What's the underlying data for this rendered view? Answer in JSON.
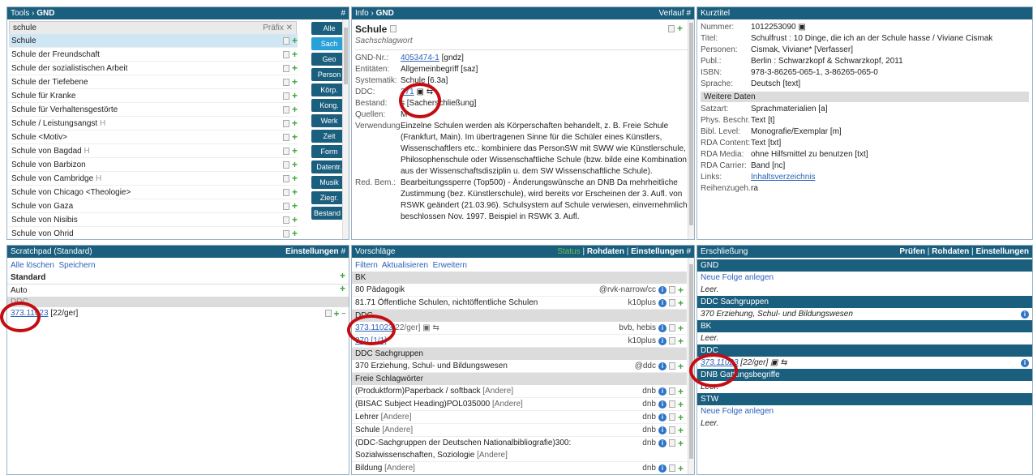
{
  "tools_gnd": {
    "title_prefix": "Tools",
    "title_sep": "›",
    "title_main": "GND",
    "hash": "#",
    "search_value": "schule",
    "prefix_label": "Präfix",
    "clear_icon": "close-icon",
    "list": [
      {
        "name": "Schule",
        "suffix": ""
      },
      {
        "name": "Schule der Freundschaft",
        "suffix": ""
      },
      {
        "name": "Schule der sozialistischen Arbeit",
        "suffix": ""
      },
      {
        "name": "Schule der Tiefebene",
        "suffix": ""
      },
      {
        "name": "Schule für Kranke",
        "suffix": ""
      },
      {
        "name": "Schule für Verhaltensgestörte",
        "suffix": ""
      },
      {
        "name": "Schule / Leistungsangst",
        "suffix": "H"
      },
      {
        "name": "Schule <Motiv>",
        "suffix": ""
      },
      {
        "name": "Schule von Bagdad",
        "suffix": "H"
      },
      {
        "name": "Schule von Barbizon",
        "suffix": ""
      },
      {
        "name": "Schule von Cambridge",
        "suffix": "H"
      },
      {
        "name": "Schule von Chicago <Theologie>",
        "suffix": ""
      },
      {
        "name": "Schule von Gaza",
        "suffix": ""
      },
      {
        "name": "Schule von Nisibis",
        "suffix": ""
      },
      {
        "name": "Schule von Ohrid",
        "suffix": ""
      }
    ],
    "buttons": [
      "Alle",
      "Sach",
      "Geo",
      "Person",
      "Körp.",
      "Kong.",
      "Werk",
      "Zeit",
      "Form",
      "Datentr.",
      "Musik",
      "Ziegr.",
      "Bestand f"
    ]
  },
  "info_gnd": {
    "title_prefix": "Info",
    "title_sep": "›",
    "title_main": "GND",
    "history": "Verlauf",
    "hash": "#",
    "heading": "Schule",
    "subtype": "Sachschlagwort",
    "fields": [
      {
        "k": "GND-Nr.:",
        "v": "4053474-1",
        "v2": " [gndz]",
        "link": true
      },
      {
        "k": "Entitäten:",
        "v": "Allgemeinbegriff [saz]",
        "v2": "",
        "link": false
      },
      {
        "k": "Systematik:",
        "v": "Schule [6.3a]",
        "v2": "",
        "link": false
      },
      {
        "k": "DDC:",
        "v": "371",
        "v2": " ▣ ⇆",
        "link": true
      },
      {
        "k": "Bestand:",
        "v": "s [Sacherschließung]",
        "v2": "",
        "link": false
      },
      {
        "k": "Quellen:",
        "v": "M",
        "v2": "",
        "link": false
      }
    ],
    "usage_label": "Verwendung:",
    "usage_text": "Einzelne Schulen werden als Körperschaften behandelt, z. B. Freie Schule (Frankfurt, Main). Im übertragenen Sinne für die Schüler eines Künstlers, Wissenschaftlers etc.: kombiniere das PersonSW mit SWW wie Künstlerschule, Philosophenschule oder Wissenschaftliche Schule (bzw. bilde eine Kombination aus der Wissenschaftsdisziplin u. dem SW Wissenschaftliche Schule).",
    "red_label": "Red. Bem.:",
    "red_text": "Bearbeitungssperre (Top500) - Änderungswünsche an DNB Da mehrheitliche Zustimmung (bez. Künstlerschule), wird bereits vor Erscheinen der 3. Aufl. von RSWK geändert (21.03.96). Schulsystem auf Schule verwiesen, einvernehmlich beschlossen Nov. 1997. Beispiel in RSWK 3. Aufl."
  },
  "kurztitel": {
    "title": "Kurztitel",
    "fields": [
      {
        "k": "Nummer:",
        "v": "1012253090 ▣"
      },
      {
        "k": "Titel:",
        "v": "Schulfrust : 10 Dinge, die ich an der Schule hasse / Viviane Cismak"
      },
      {
        "k": "Personen:",
        "v": "Cismak, Viviane* [Verfasser]"
      },
      {
        "k": "Publ.:",
        "v": "Berlin : Schwarzkopf & Schwarzkopf, 2011"
      },
      {
        "k": "ISBN:",
        "v": "978-3-86265-065-1, 3-86265-065-0"
      },
      {
        "k": "Sprache:",
        "v": "Deutsch [text]"
      }
    ],
    "section": "Weitere Daten",
    "more": [
      {
        "k": "Satzart:",
        "v": "Sprachmaterialien [a]"
      },
      {
        "k": "Phys. Beschr.:",
        "v": "Text [t]"
      },
      {
        "k": "Bibl. Level:",
        "v": "Monografie/Exemplar [m]"
      },
      {
        "k": "RDA Content:",
        "v": "Text [txt]"
      },
      {
        "k": "RDA Media:",
        "v": "ohne Hilfsmittel zu benutzen [txt]"
      },
      {
        "k": "RDA Carrier:",
        "v": "Band [nc]"
      },
      {
        "k": "Links:",
        "v": "Inhaltsverzeichnis"
      },
      {
        "k": "Reihenzugeh.:",
        "v": "ra"
      }
    ]
  },
  "scratchpad": {
    "title": "Scratchpad (Standard)",
    "settings": "Einstellungen",
    "hash": "#",
    "delete_all": "Alle löschen",
    "save": "Speichern",
    "standard": "Standard",
    "auto": "Auto",
    "group": "DDC",
    "item_link": "373.11023",
    "item_rest": "[22/ger]"
  },
  "vorschlaege": {
    "title": "Vorschläge",
    "status": "Status",
    "rohdaten": "Rohdaten",
    "settings": "Einstellungen",
    "hash": "#",
    "filter": "Filtern",
    "refresh": "Aktualisieren",
    "extend": "Erweitern",
    "groups": [
      {
        "name": "BK",
        "items": [
          {
            "text": "80 Pädagogik",
            "src": "@rvk-narrow/cc"
          },
          {
            "text": "81.71 Öffentliche Schulen, nichtöffentliche Schulen",
            "src": "k10plus"
          }
        ]
      },
      {
        "name": "DDC",
        "items": [
          {
            "text": "373.11023",
            "rest": "[22/ger] ▣ ⇆",
            "src": "bvb, hebis",
            "link": true
          },
          {
            "text": "370 [1/1]",
            "rest": "",
            "src": "k10plus",
            "link": true
          }
        ]
      },
      {
        "name": "DDC Sachgruppen",
        "items": [
          {
            "text": "370 Erziehung, Schul- und Bildungswesen",
            "src": "@ddc"
          }
        ]
      },
      {
        "name": "Freie Schlagwörter",
        "items": [
          {
            "text": "(Produktform)Paperback / softback",
            "rest": " [Andere]",
            "src": "dnb"
          },
          {
            "text": "(BISAC Subject Heading)POL035000",
            "rest": " [Andere]",
            "src": "dnb"
          },
          {
            "text": "Lehrer",
            "rest": " [Andere]",
            "src": "dnb"
          },
          {
            "text": "Schule",
            "rest": " [Andere]",
            "src": "dnb"
          },
          {
            "text": "(DDC-Sachgruppen der Deutschen Nationalbibliografie)300: Sozialwissenschaften, Soziologie",
            "rest": " [Andere]",
            "src": "dnb"
          },
          {
            "text": "Bildung",
            "rest": " [Andere]",
            "src": "dnb"
          }
        ]
      }
    ]
  },
  "erschliessung": {
    "title": "Erschließung",
    "check": "Prüfen",
    "rohdaten": "Rohdaten",
    "settings": "Einstellungen",
    "blocks": [
      {
        "head": "GND",
        "lines": [
          {
            "t": "Neue Folge anlegen",
            "type": "link"
          },
          {
            "t": "Leer.",
            "type": "italic"
          }
        ]
      },
      {
        "head": "DDC Sachgruppen",
        "lines": [
          {
            "t": "370 Erziehung, Schul- und Bildungswesen",
            "type": "italic"
          }
        ]
      },
      {
        "head": "BK",
        "lines": [
          {
            "t": "Leer.",
            "type": "italic"
          }
        ]
      },
      {
        "head": "DDC",
        "lines": [
          {
            "t": "373.11023",
            "rest": " [22/ger] ▣ ⇆",
            "type": "ddc"
          }
        ]
      },
      {
        "head": "DNB Gattungsbegriffe",
        "lines": [
          {
            "t": "Leer.",
            "type": "italic"
          }
        ]
      },
      {
        "head": "STW",
        "lines": [
          {
            "t": "Neue Folge anlegen",
            "type": "link"
          },
          {
            "t": "Leer.",
            "type": "italic"
          }
        ]
      }
    ]
  },
  "colors": {
    "header": "#1b5f7e",
    "selected": "#cfe6f4",
    "highlight_circle": "#c40d12",
    "green": "#6fbf4a"
  }
}
